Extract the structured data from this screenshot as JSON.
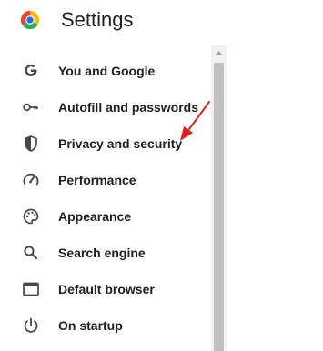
{
  "header": {
    "title": "Settings",
    "logo": "chrome-logo"
  },
  "sidebar": {
    "items": [
      {
        "label": "You and Google",
        "icon": "google-g-icon"
      },
      {
        "label": "Autofill and passwords",
        "icon": "key-icon"
      },
      {
        "label": "Privacy and security",
        "icon": "shield-icon"
      },
      {
        "label": "Performance",
        "icon": "speedometer-icon"
      },
      {
        "label": "Appearance",
        "icon": "palette-icon"
      },
      {
        "label": "Search engine",
        "icon": "search-icon"
      },
      {
        "label": "Default browser",
        "icon": "browser-window-icon"
      },
      {
        "label": "On startup",
        "icon": "power-icon"
      }
    ]
  },
  "annotation": {
    "type": "red-arrow",
    "points_to": "Privacy and security",
    "color": "#e02020"
  },
  "colors": {
    "text": "#1f1f1f",
    "icon": "#474747",
    "scrollbar_track": "#f1f1f1",
    "scrollbar_thumb": "#c1c1c1"
  }
}
